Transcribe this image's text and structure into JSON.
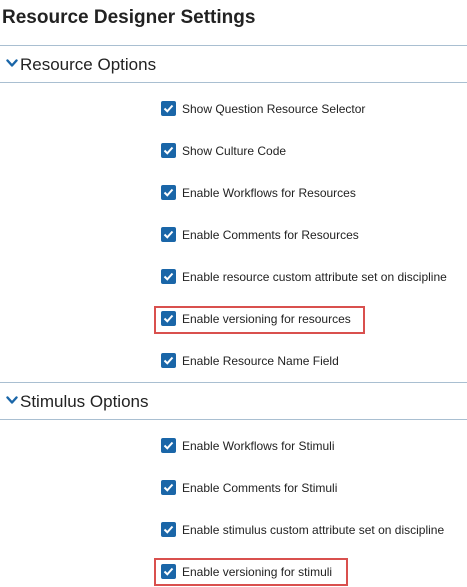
{
  "page": {
    "title": "Resource Designer Settings"
  },
  "sections": [
    {
      "title": "Resource Options",
      "expanded": true,
      "options": [
        {
          "label": "Show Question Resource Selector",
          "checked": true,
          "highlighted": false
        },
        {
          "label": "Show Culture Code",
          "checked": true,
          "highlighted": false
        },
        {
          "label": "Enable Workflows for Resources",
          "checked": true,
          "highlighted": false
        },
        {
          "label": "Enable Comments for Resources",
          "checked": true,
          "highlighted": false
        },
        {
          "label": "Enable resource custom attribute set on discipline",
          "checked": true,
          "highlighted": false
        },
        {
          "label": "Enable versioning for resources",
          "checked": true,
          "highlighted": true
        },
        {
          "label": "Enable Resource Name Field",
          "checked": true,
          "highlighted": false
        }
      ]
    },
    {
      "title": "Stimulus Options",
      "expanded": true,
      "options": [
        {
          "label": "Enable Workflows for Stimuli",
          "checked": true,
          "highlighted": false
        },
        {
          "label": "Enable Comments for Stimuli",
          "checked": true,
          "highlighted": false
        },
        {
          "label": "Enable stimulus custom attribute set on discipline",
          "checked": true,
          "highlighted": false
        },
        {
          "label": "Enable versioning for stimuli",
          "checked": true,
          "highlighted": true
        }
      ]
    }
  ],
  "colors": {
    "checkbox": "#1a66a8",
    "chevron": "#1a66a8",
    "divider": "#a9bfd1",
    "highlight": "#d9504e"
  },
  "icons": {
    "section_toggle": "chevron-down-icon",
    "checkbox_mark": "checkmark-icon"
  }
}
